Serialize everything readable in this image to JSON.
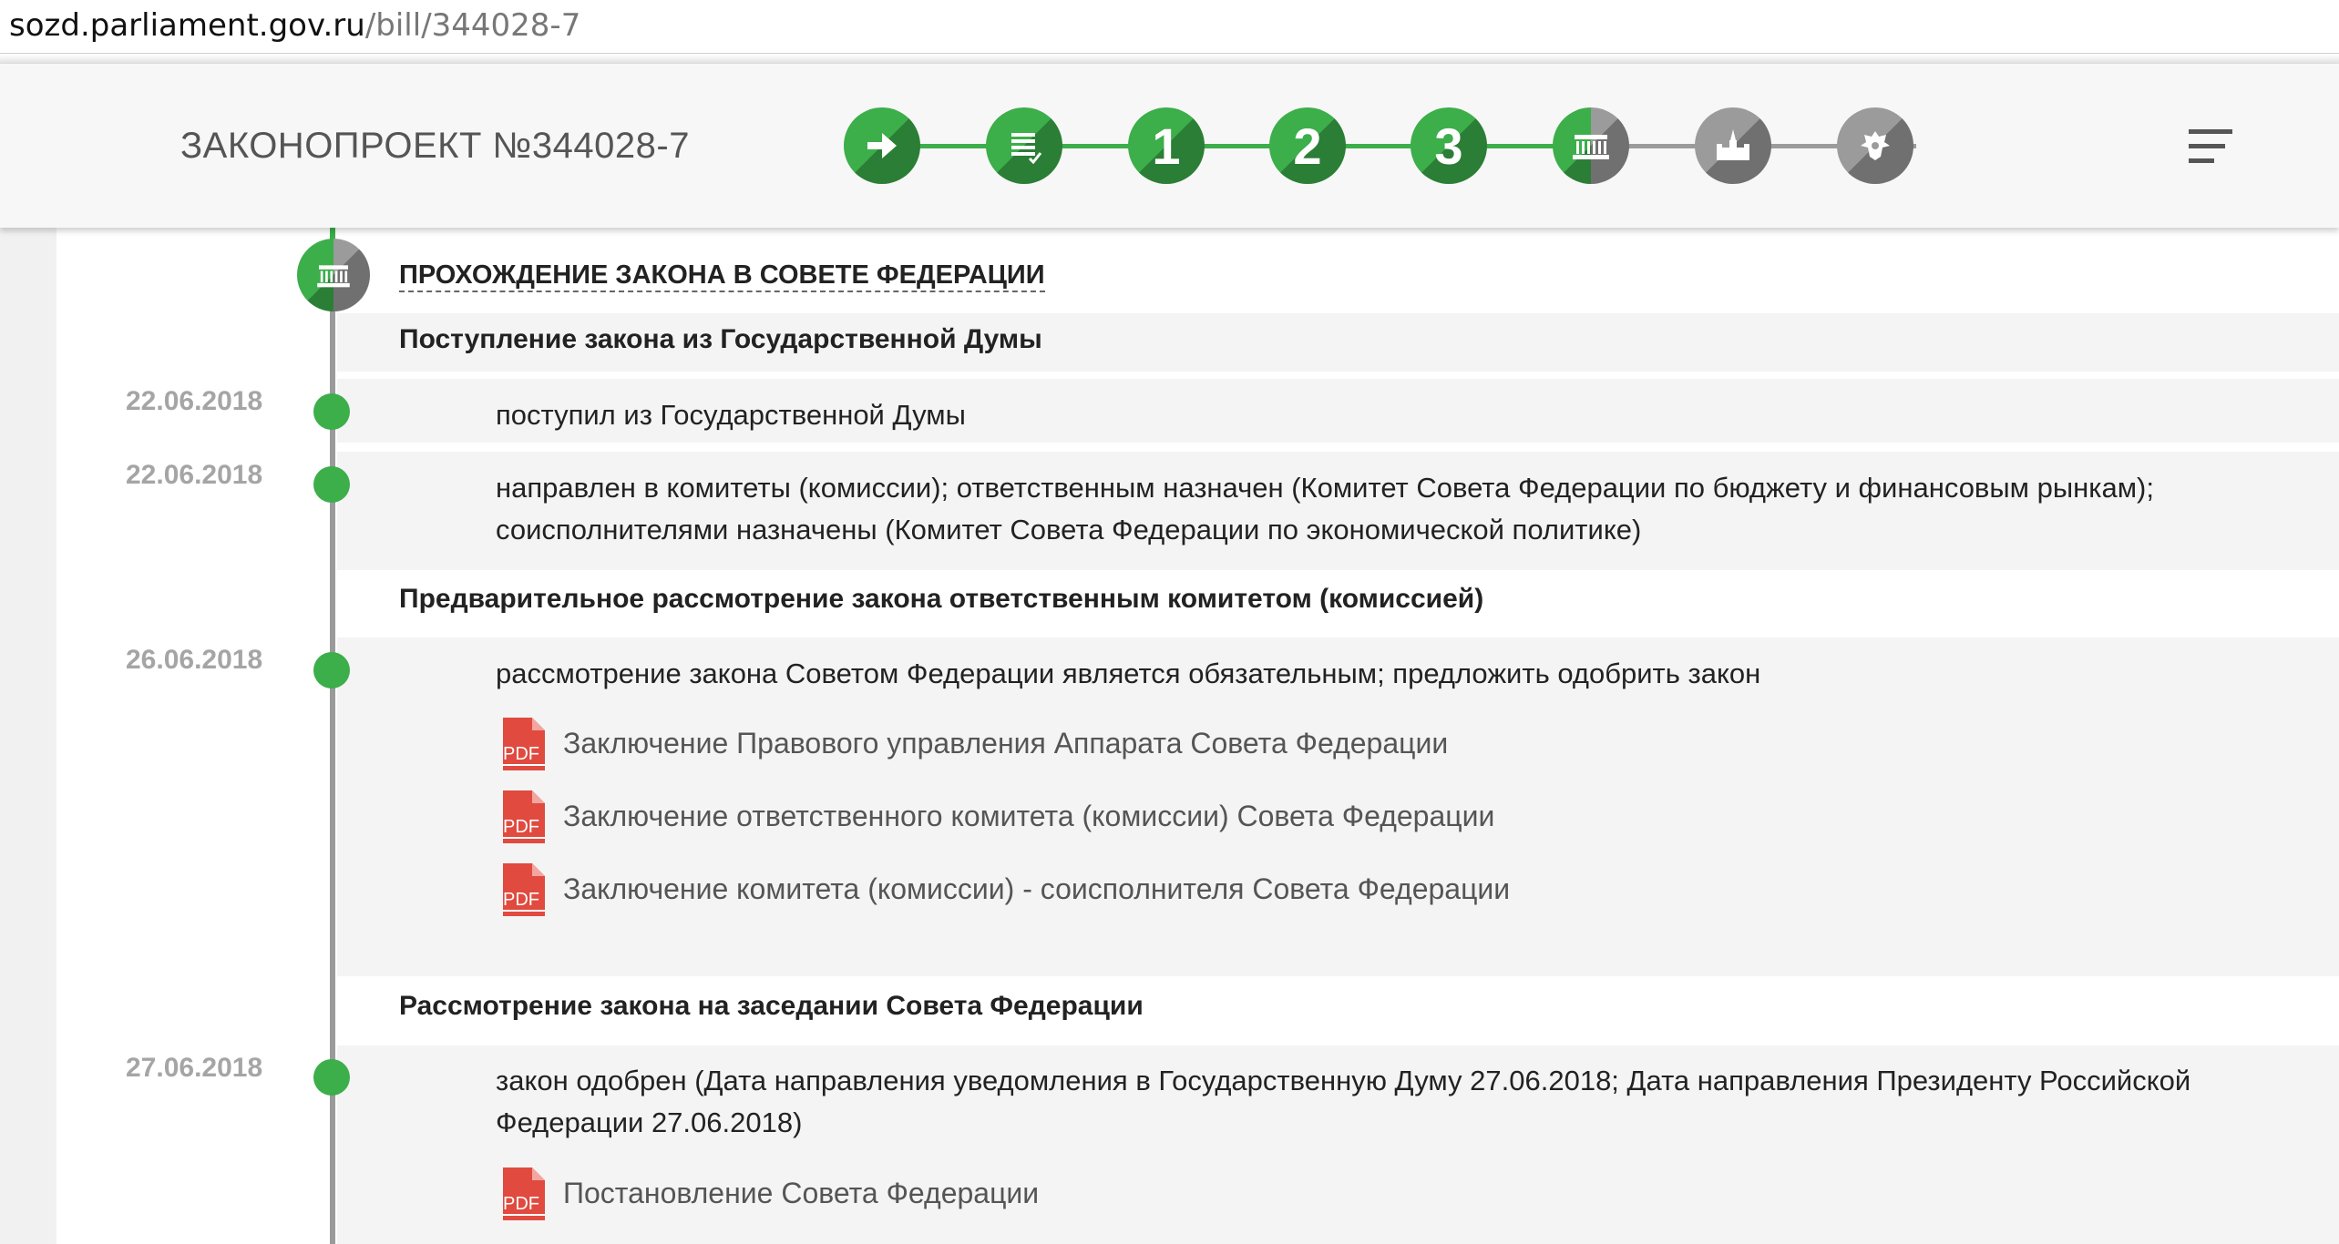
{
  "browser": {
    "url_host": "sozd.parliament.gov.ru",
    "url_path": "/bill/344028-7"
  },
  "header": {
    "bill_title": "ЗАКОНОПРОЕКТ №344028-7",
    "steps": [
      {
        "name": "step-introduction",
        "label": "",
        "icon": "arrow-right-icon",
        "state": "done"
      },
      {
        "name": "step-preliminary",
        "label": "",
        "icon": "document-list-icon",
        "state": "done"
      },
      {
        "name": "step-reading-1",
        "label": "1",
        "icon": "",
        "state": "done"
      },
      {
        "name": "step-reading-2",
        "label": "2",
        "icon": "",
        "state": "done"
      },
      {
        "name": "step-reading-3",
        "label": "3",
        "icon": "",
        "state": "done"
      },
      {
        "name": "step-federation-council",
        "label": "",
        "icon": "building-columns-icon",
        "state": "active"
      },
      {
        "name": "step-president",
        "label": "",
        "icon": "kremlin-icon",
        "state": "pending"
      },
      {
        "name": "step-publication",
        "label": "",
        "icon": "emblem-icon",
        "state": "pending"
      }
    ]
  },
  "colors": {
    "accent_green": "#3cae4a",
    "pending_gray": "#9b9b9b",
    "pdf_red": "#e04a3f",
    "date_gray": "#a5a5a5"
  },
  "section": {
    "title": "ПРОХОЖДЕНИЕ ЗАКОНА В СОВЕТЕ ФЕДЕРАЦИИ",
    "stages": [
      {
        "title": "Поступление закона из Государственной Думы",
        "events": [
          {
            "date": "22.06.2018",
            "text": "поступил из Государственной Думы",
            "documents": []
          },
          {
            "date": "22.06.2018",
            "text": "направлен в комитеты (комиссии); ответственным назначен (Комитет Совета Федерации по бюджету и финансовым рынкам); соисполнителями назначены (Комитет Совета Федерации по экономической политике)",
            "documents": []
          }
        ]
      },
      {
        "title": "Предварительное рассмотрение закона ответственным комитетом (комиссией)",
        "events": [
          {
            "date": "26.06.2018",
            "text": "рассмотрение закона Советом Федерации является обязательным; предложить одобрить закон",
            "documents": [
              {
                "label": "Заключение Правового управления Аппарата Совета Федерации",
                "type": "PDF"
              },
              {
                "label": "Заключение ответственного комитета (комиссии) Совета Федерации",
                "type": "PDF"
              },
              {
                "label": "Заключение комитета (комиссии) - соисполнителя Совета Федерации",
                "type": "PDF"
              }
            ]
          }
        ]
      },
      {
        "title": "Рассмотрение закона на заседании Совета Федерации",
        "events": [
          {
            "date": "27.06.2018",
            "text": "закон одобрен (Дата направления уведомления в Государственную Думу 27.06.2018; Дата направления Президенту Российской Федерации 27.06.2018)",
            "documents": [
              {
                "label": "Постановление Совета Федерации",
                "type": "PDF"
              }
            ]
          }
        ]
      }
    ]
  }
}
